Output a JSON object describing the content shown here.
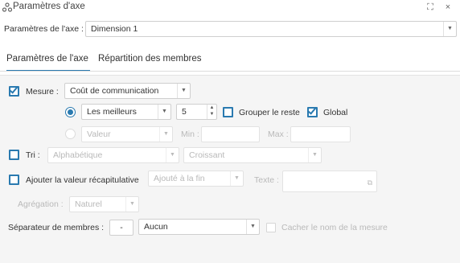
{
  "window": {
    "title": "Paramètres d'axe",
    "maximize_glyph": "⛶",
    "close_glyph": "×"
  },
  "axis": {
    "label": "Paramètres de l'axe :",
    "selected": "Dimension 1"
  },
  "tabs": [
    {
      "label": "Paramètres de l'axe",
      "active": true
    },
    {
      "label": "Répartition des membres",
      "active": false
    }
  ],
  "measure": {
    "checked": true,
    "label": "Mesure :",
    "selected": "Coût de communication",
    "best_option": "Les meilleurs",
    "count": "5",
    "group_rest_label": "Grouper le reste",
    "group_rest_checked": false,
    "global_label": "Global",
    "global_checked": true,
    "value_placeholder": "Valeur",
    "min_label": "Min :",
    "max_label": "Max :"
  },
  "sort": {
    "checked": false,
    "label": "Tri :",
    "type": "Alphabétique",
    "order": "Croissant"
  },
  "summary": {
    "checked": false,
    "label": "Ajouter la valeur récapitulative",
    "position": "Ajouté à la fin",
    "text_label": "Texte :",
    "aggregation_label": "Agrégation :",
    "aggregation": "Naturel"
  },
  "separator": {
    "label": "Séparateur de membres :",
    "symbol": "-",
    "selected": "Aucun",
    "hide_label": "Cacher le nom de la mesure",
    "hide_checked": false
  },
  "colors": {
    "accent": "#2a7ab0",
    "panel_bg": "#f5f5f5",
    "disabled_text": "#b9b9b9"
  }
}
